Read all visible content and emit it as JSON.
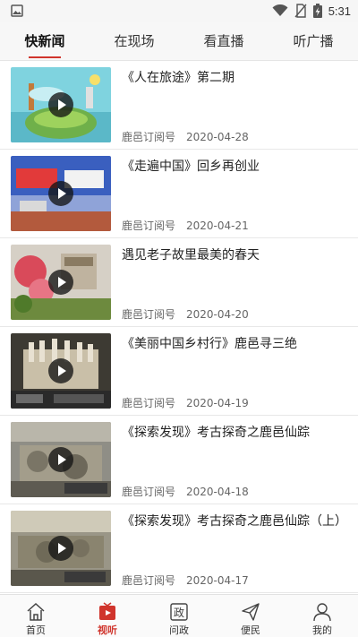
{
  "status_bar": {
    "time": "5:31",
    "icons": [
      "image-icon",
      "wifi-icon",
      "no-sim-icon",
      "battery-charging-icon"
    ]
  },
  "top_tabs": [
    {
      "label": "快新闻",
      "active": true
    },
    {
      "label": "在现场",
      "active": false
    },
    {
      "label": "看直播",
      "active": false
    },
    {
      "label": "听广播",
      "active": false
    }
  ],
  "news": [
    {
      "title": "《人在旅途》第二期",
      "source": "鹿邑订阅号",
      "date": "2020-04-28"
    },
    {
      "title": "《走遍中国》回乡再创业",
      "source": "鹿邑订阅号",
      "date": "2020-04-21"
    },
    {
      "title": "遇见老子故里最美的春天",
      "source": "鹿邑订阅号",
      "date": "2020-04-20"
    },
    {
      "title": "《美丽中国乡村行》鹿邑寻三绝",
      "source": "鹿邑订阅号",
      "date": "2020-04-19"
    },
    {
      "title": "《探索发现》考古探奇之鹿邑仙踪",
      "source": "鹿邑订阅号",
      "date": "2020-04-18"
    },
    {
      "title": "《探索发现》考古探奇之鹿邑仙踪（上）",
      "source": "鹿邑订阅号",
      "date": "2020-04-17"
    }
  ],
  "bottom_nav": [
    {
      "label": "首页",
      "icon": "home-icon",
      "active": false
    },
    {
      "label": "视听",
      "icon": "tv-icon",
      "active": true
    },
    {
      "label": "问政",
      "icon": "zheng-icon",
      "glyph": "政",
      "active": false
    },
    {
      "label": "便民",
      "icon": "send-icon",
      "active": false
    },
    {
      "label": "我的",
      "icon": "person-icon",
      "active": false
    }
  ],
  "colors": {
    "accent": "#d0342c"
  }
}
